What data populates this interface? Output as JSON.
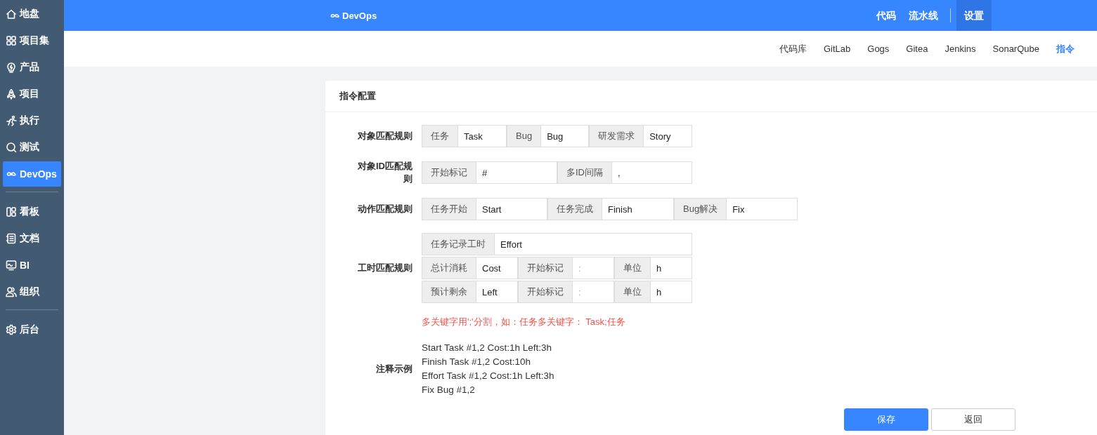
{
  "sidebar": {
    "groups": [
      [
        {
          "label": "地盘",
          "selected": false
        },
        {
          "label": "项目集",
          "selected": false
        },
        {
          "label": "产品",
          "selected": false
        },
        {
          "label": "项目",
          "selected": false
        },
        {
          "label": "执行",
          "selected": false
        },
        {
          "label": "测试",
          "selected": false
        },
        {
          "label": "DevOps",
          "selected": true
        }
      ],
      [
        {
          "label": "看板",
          "selected": false
        },
        {
          "label": "文档",
          "selected": false
        },
        {
          "label": "BI",
          "selected": false
        },
        {
          "label": "组织",
          "selected": false
        }
      ],
      [
        {
          "label": "后台",
          "selected": false
        }
      ]
    ]
  },
  "topbar": {
    "brand": "DevOps",
    "nav_groups": [
      [
        {
          "label": "代码",
          "selected": false
        },
        {
          "label": "流水线",
          "selected": false
        }
      ],
      [
        {
          "label": "设置",
          "selected": true
        }
      ]
    ]
  },
  "subnav": {
    "items": [
      {
        "label": "代码库",
        "selected": false
      },
      {
        "label": "GitLab",
        "selected": false
      },
      {
        "label": "Gogs",
        "selected": false
      },
      {
        "label": "Gitea",
        "selected": false
      },
      {
        "label": "Jenkins",
        "selected": false
      },
      {
        "label": "SonarQube",
        "selected": false
      },
      {
        "label": "指令",
        "selected": true
      }
    ]
  },
  "card": {
    "title": "指令配置",
    "rows": [
      {
        "label": "对象匹配规则",
        "lines": [
          [
            {
              "addon": "任务",
              "value": "Task"
            },
            {
              "addon": "Bug",
              "value": "Bug"
            },
            {
              "addon": "研发需求",
              "value": "Story"
            }
          ]
        ]
      },
      {
        "label": "对象ID匹配规则",
        "lines": [
          [
            {
              "addon": "开始标记",
              "value": "#"
            },
            {
              "addon": "多ID间隔",
              "value": ","
            }
          ]
        ]
      },
      {
        "label": "动作匹配规则",
        "lines": [
          [
            {
              "addon": "任务开始",
              "value": "Start"
            },
            {
              "addon": "任务完成",
              "value": "Finish"
            },
            {
              "addon": "Bug解决",
              "value": "Fix"
            }
          ]
        ]
      },
      {
        "label": "工时匹配规则",
        "lines": [
          [
            {
              "addon": "任务记录工时",
              "value": "Effort"
            }
          ],
          [
            {
              "addon": "总计消耗",
              "value": "Cost"
            },
            {
              "addon": "开始标记",
              "placeholder": ":"
            },
            {
              "addon": "单位",
              "value": "h"
            }
          ],
          [
            {
              "addon": "预计剩余",
              "value": "Left"
            },
            {
              "addon": "开始标记",
              "placeholder": ":"
            },
            {
              "addon": "单位",
              "value": "h"
            }
          ]
        ]
      }
    ],
    "note": "多关键字用';'分割，如：任务多关键字： Task;任务",
    "example": {
      "label": "注释示例",
      "lines": [
        "Start Task #1,2 Cost:1h Left:3h",
        "Finish Task #1,2 Cost:10h",
        "Effort Task #1,2 Cost:1h Left:3h",
        "Fix Bug #1,2"
      ]
    },
    "buttons": [
      {
        "label": "保存",
        "kind": "primary"
      },
      {
        "label": "返回",
        "kind": "default"
      }
    ]
  }
}
